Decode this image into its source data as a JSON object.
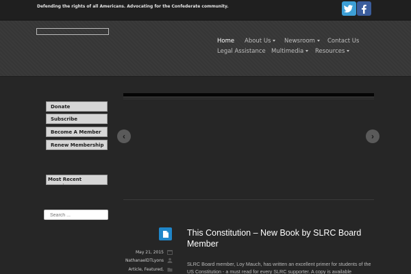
{
  "topbar": {
    "tagline": "Defending the rights of all Americans. Advocating for the Confederate community.",
    "social": [
      {
        "name": "twitter-icon",
        "color": "#3d9fd6"
      },
      {
        "name": "facebook-icon",
        "color": "#3b5d9c"
      }
    ]
  },
  "nav": {
    "row1": [
      "Home",
      "About Us",
      "Newsroom",
      "Contact Us"
    ],
    "row2": [
      "Legal Assistance",
      "Multimedia",
      "Resources"
    ]
  },
  "sidebar": {
    "buttons": [
      "Donate",
      "Subscribe",
      "Become A Member",
      "Renew Membership"
    ],
    "newsletter": "Most Recent Newsletter",
    "search_placeholder": "Search ..."
  },
  "slider": {
    "prev_label": "‹",
    "next_label": "›"
  },
  "post": {
    "title": "This Constitution – New Book by SLRC Board Member",
    "date": "May 21, 2015",
    "author": "NathanaelDTLyons",
    "categories": "Article, Featured,",
    "excerpt": "SLRC Board member, Loy Mauch, has written an excellent primer for students of the US Constitution - a must read for every SLRC supporter. A copy is available"
  },
  "colors": {
    "accent": "#1f86c9",
    "background": "#262626"
  }
}
